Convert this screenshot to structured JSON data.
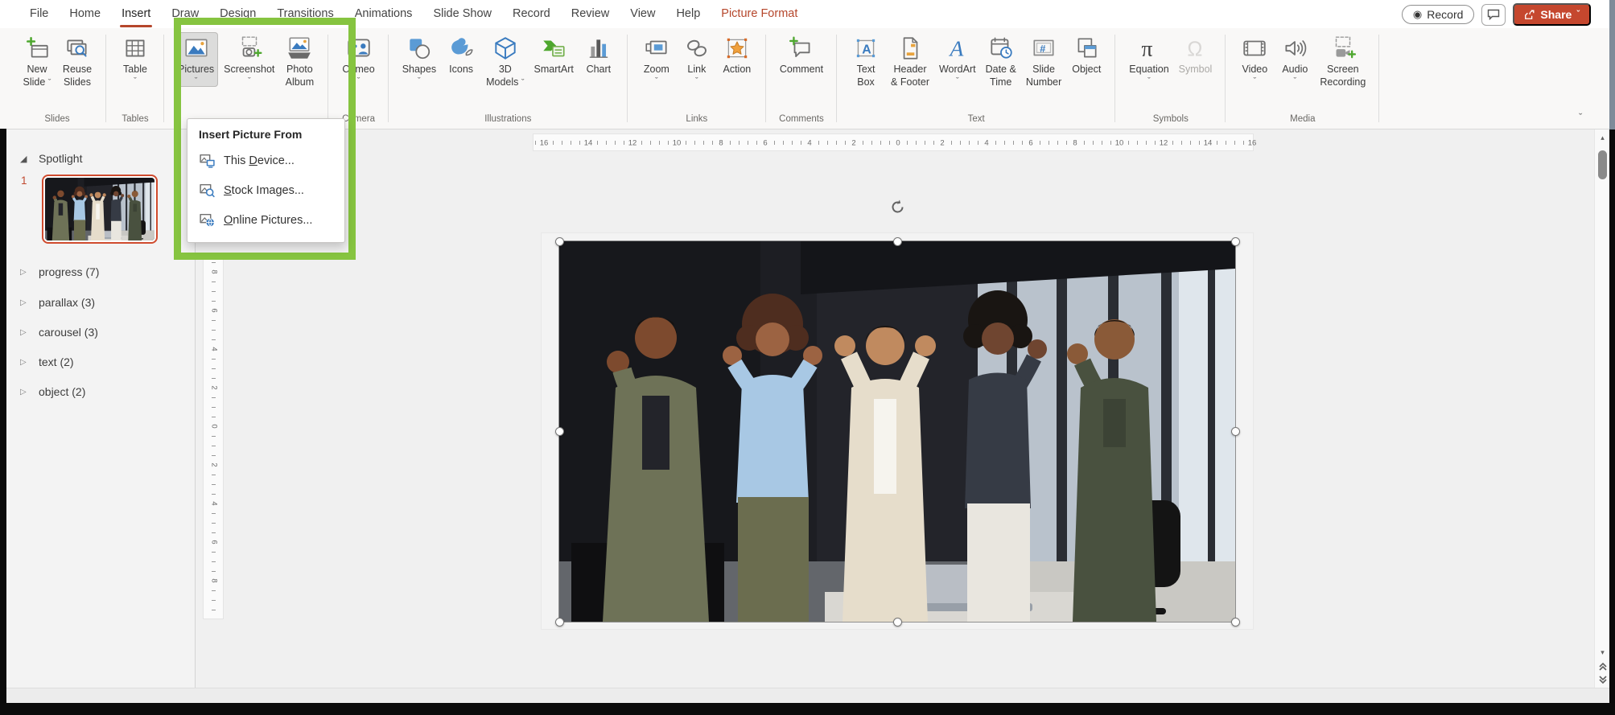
{
  "app": {
    "accent_color": "#c5472e",
    "highlight_color": "#86c440"
  },
  "menubar": {
    "tabs": [
      {
        "label": "File"
      },
      {
        "label": "Home"
      },
      {
        "label": "Insert",
        "active": true
      },
      {
        "label": "Draw"
      },
      {
        "label": "Design"
      },
      {
        "label": "Transitions"
      },
      {
        "label": "Animations"
      },
      {
        "label": "Slide Show"
      },
      {
        "label": "Record"
      },
      {
        "label": "Review"
      },
      {
        "label": "View"
      },
      {
        "label": "Help"
      },
      {
        "label": "Picture Format",
        "contextual": true
      }
    ],
    "record_button": "Record",
    "share_button": "Share"
  },
  "ribbon": {
    "groups": [
      {
        "label": "Slides",
        "buttons": [
          {
            "lines": [
              "New",
              "Slide"
            ],
            "icon": "new-slide",
            "chevron": "inline"
          },
          {
            "lines": [
              "Reuse",
              "Slides"
            ],
            "icon": "reuse-slides"
          }
        ]
      },
      {
        "label": "Tables",
        "buttons": [
          {
            "lines": [
              "Table"
            ],
            "icon": "table",
            "chevron": "below"
          }
        ]
      },
      {
        "label": "",
        "buttons": [
          {
            "lines": [
              "Pictures"
            ],
            "icon": "pictures",
            "chevron": "below",
            "selected": true
          },
          {
            "lines": [
              "Screenshot"
            ],
            "icon": "screenshot",
            "chevron": "below"
          },
          {
            "lines": [
              "Photo",
              "Album"
            ],
            "icon": "photo-album"
          }
        ]
      },
      {
        "label": "Camera",
        "buttons": [
          {
            "lines": [
              "Cameo"
            ],
            "icon": "cameo",
            "chevron": "below"
          }
        ]
      },
      {
        "label": "Illustrations",
        "buttons": [
          {
            "lines": [
              "Shapes"
            ],
            "icon": "shapes",
            "chevron": "below"
          },
          {
            "lines": [
              "Icons"
            ],
            "icon": "icons"
          },
          {
            "lines": [
              "3D",
              "Models"
            ],
            "icon": "three-d-models",
            "chevron": "inline"
          },
          {
            "lines": [
              "SmartArt"
            ],
            "icon": "smartart"
          },
          {
            "lines": [
              "Chart"
            ],
            "icon": "chart"
          }
        ]
      },
      {
        "label": "Links",
        "buttons": [
          {
            "lines": [
              "Zoom"
            ],
            "icon": "zoom",
            "chevron": "below"
          },
          {
            "lines": [
              "Link"
            ],
            "icon": "link",
            "chevron": "below"
          },
          {
            "lines": [
              "Action"
            ],
            "icon": "action"
          }
        ]
      },
      {
        "label": "Comments",
        "buttons": [
          {
            "lines": [
              "Comment"
            ],
            "icon": "comment"
          }
        ]
      },
      {
        "label": "Text",
        "buttons": [
          {
            "lines": [
              "Text",
              "Box"
            ],
            "icon": "text-box"
          },
          {
            "lines": [
              "Header",
              "& Footer"
            ],
            "icon": "header-footer"
          },
          {
            "lines": [
              "WordArt"
            ],
            "icon": "wordart",
            "chevron": "below"
          },
          {
            "lines": [
              "Date &",
              "Time"
            ],
            "icon": "date-time"
          },
          {
            "lines": [
              "Slide",
              "Number"
            ],
            "icon": "slide-number"
          },
          {
            "lines": [
              "Object"
            ],
            "icon": "object"
          }
        ]
      },
      {
        "label": "Symbols",
        "buttons": [
          {
            "lines": [
              "Equation"
            ],
            "icon": "equation",
            "chevron": "below"
          },
          {
            "lines": [
              "Symbol"
            ],
            "icon": "symbol",
            "disabled": true
          }
        ]
      },
      {
        "label": "Media",
        "buttons": [
          {
            "lines": [
              "Video"
            ],
            "icon": "video",
            "chevron": "below"
          },
          {
            "lines": [
              "Audio"
            ],
            "icon": "audio",
            "chevron": "below"
          },
          {
            "lines": [
              "Screen",
              "Recording"
            ],
            "icon": "screen-recording"
          }
        ]
      }
    ]
  },
  "dropdown": {
    "title": "Insert Picture From",
    "items": [
      {
        "icon": "picture-device",
        "pre": "This ",
        "u": "D",
        "post": "evice..."
      },
      {
        "icon": "picture-search",
        "pre": "",
        "u": "S",
        "post": "tock Images..."
      },
      {
        "icon": "picture-globe",
        "pre": "",
        "u": "O",
        "post": "nline Pictures..."
      }
    ]
  },
  "sidebar": {
    "sections": [
      {
        "label": "Spotlight",
        "expanded": true,
        "slide_number": "1",
        "selected": true
      },
      {
        "label": "progress (7)"
      },
      {
        "label": "parallax (3)"
      },
      {
        "label": "carousel (3)"
      },
      {
        "label": "text (2)"
      },
      {
        "label": "object (2)"
      }
    ]
  },
  "rulers": {
    "horizontal": [
      "16",
      "14",
      "12",
      "10",
      "8",
      "6",
      "4",
      "2",
      "0",
      "2",
      "4",
      "6",
      "8",
      "10",
      "12",
      "14",
      "16"
    ],
    "vertical": [
      "8",
      "6",
      "4",
      "2",
      "0",
      "2",
      "4",
      "6",
      "8"
    ]
  }
}
